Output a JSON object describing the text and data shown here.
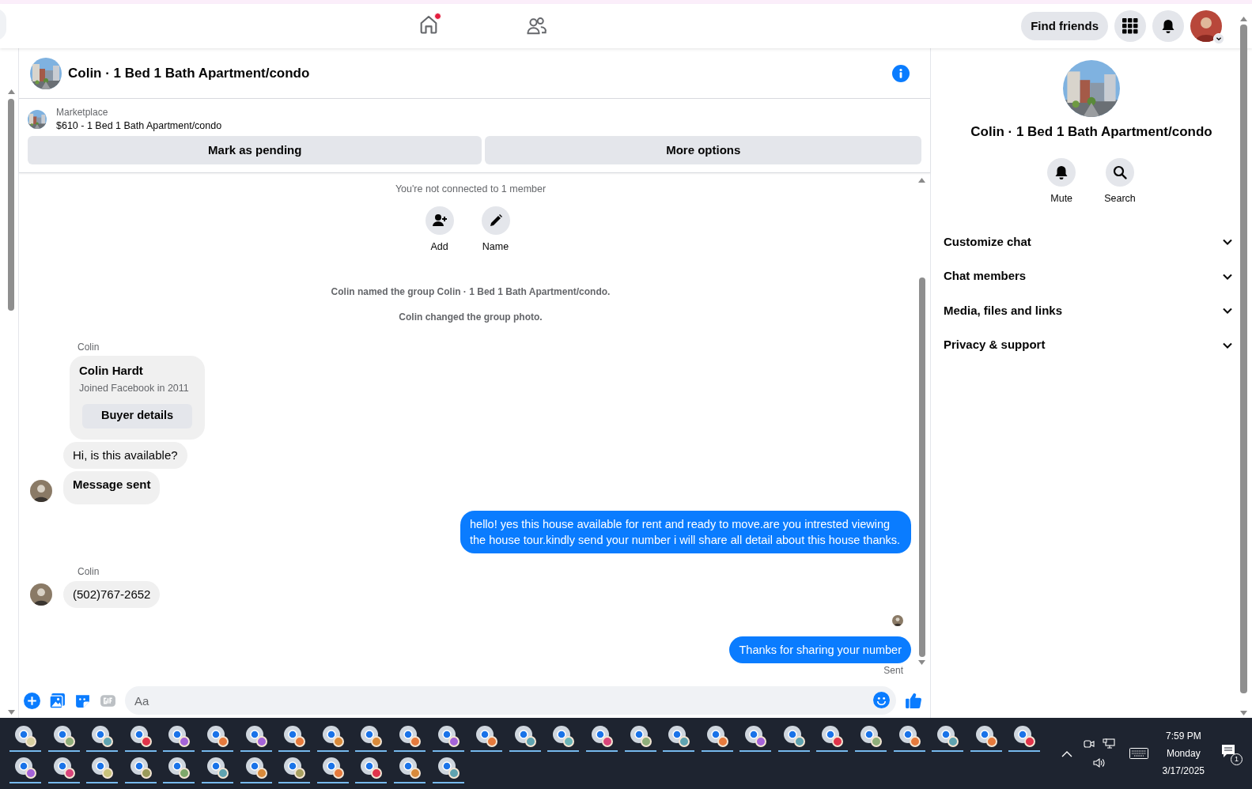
{
  "top_nav": {
    "home_badge": true,
    "find_friends": "Find friends"
  },
  "chat": {
    "title": "Colin · 1 Bed 1 Bath Apartment/condo",
    "listing": {
      "source": "Marketplace",
      "title": "$610 - 1 Bed 1 Bath Apartment/condo"
    },
    "actions": [
      "Mark as pending",
      "More options"
    ],
    "notice": "You're not connected to 1 member",
    "group_actions": [
      {
        "kind": "add",
        "label": "Add"
      },
      {
        "kind": "name",
        "label": "Name"
      }
    ],
    "messages": [
      {
        "kind": "system",
        "text": "Colin named the group Colin · 1 Bed 1 Bath Apartment/condo."
      },
      {
        "kind": "system",
        "text": "Colin changed the group photo."
      },
      {
        "kind": "sender",
        "text": "Colin"
      },
      {
        "kind": "card",
        "name": "Colin Hardt",
        "subtitle": "Joined Facebook in 2011",
        "button": "Buyer details"
      },
      {
        "kind": "incoming",
        "text": "Hi, is this available?",
        "avatar": false,
        "bold": false
      },
      {
        "kind": "incoming",
        "text": "Message sent",
        "avatar": true,
        "bold": true
      },
      {
        "kind": "outgoing",
        "text": "hello! yes this house available for rent and ready to move.are you intrested viewing the house tour.kindly send your number i will share all detail about this house thanks."
      },
      {
        "kind": "sender",
        "text": "Colin"
      },
      {
        "kind": "incoming",
        "text": "(502)767-2652",
        "avatar": true,
        "bold": false
      },
      {
        "kind": "seen"
      },
      {
        "kind": "outgoing",
        "text": "Thanks for sharing your number"
      },
      {
        "kind": "status",
        "text": "Sent"
      }
    ],
    "composer": {
      "placeholder": "Aa"
    }
  },
  "details": {
    "title": "Colin · 1 Bed 1 Bath Apartment/condo",
    "actions": [
      {
        "kind": "mute",
        "label": "Mute"
      },
      {
        "kind": "search",
        "label": "Search"
      }
    ],
    "sections": [
      {
        "label": "Customize chat",
        "expanded": false
      },
      {
        "label": "Chat members",
        "expanded": false
      },
      {
        "label": "Media, files and links",
        "expanded": false
      },
      {
        "label": "Privacy & support",
        "expanded": false
      }
    ]
  },
  "taskbar": {
    "apps": [
      {
        "color": "#d8cfa0"
      },
      {
        "color": "#8fae7a"
      },
      {
        "color": "#5fa3b0"
      },
      {
        "color": "#e0344a"
      },
      {
        "color": "#a463d8"
      },
      {
        "color": "#e67a3c"
      },
      {
        "color": "#a463d8"
      },
      {
        "color": "#e67a3c"
      },
      {
        "color": "#d98a3a"
      },
      {
        "color": "#d98a3a"
      },
      {
        "color": "#e67a3c"
      },
      {
        "color": "#a463d8"
      },
      {
        "color": "#e67a3c"
      },
      {
        "color": "#5fa3b0"
      },
      {
        "color": "#6bb5b8"
      },
      {
        "color": "#d9457a"
      },
      {
        "color": "#8fae7a"
      },
      {
        "color": "#5fa3b0"
      },
      {
        "color": "#e67a3c"
      },
      {
        "color": "#a463d8"
      },
      {
        "color": "#5fa3b0"
      },
      {
        "color": "#e0344a"
      },
      {
        "color": "#8fae7a"
      },
      {
        "color": "#e67a3c"
      },
      {
        "color": "#5fa3b0"
      },
      {
        "color": "#e67a3c"
      },
      {
        "color": "#e0344a"
      },
      {
        "color": "#a463d8"
      },
      {
        "color": "#d9457a"
      },
      {
        "color": "#c9c27a"
      },
      {
        "color": "#9a9a5a"
      },
      {
        "color": "#7ea86a"
      },
      {
        "color": "#5fa3b0"
      },
      {
        "color": "#d98a3a"
      },
      {
        "color": "#a8a060"
      },
      {
        "color": "#e67a3c"
      },
      {
        "color": "#e0344a"
      },
      {
        "color": "#d98a3a"
      },
      {
        "color": "#5fa3b0"
      }
    ],
    "time": "7:59 PM",
    "day": "Monday",
    "date": "3/17/2025",
    "notifications": "1"
  }
}
